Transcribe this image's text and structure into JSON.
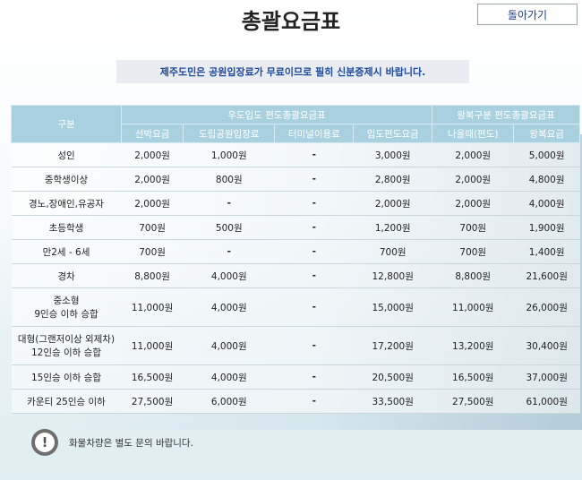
{
  "header": {
    "title": "총괄요금표",
    "back_label": "돌아가기"
  },
  "notice": "제주도민은 공원입장료가 무료이므로 필히 신분증제시 바랍니다.",
  "table": {
    "gubun_label": "구분",
    "group1_label": "우도입도 편도총괄요금표",
    "group2_label": "왕복구분 편도총괄요금표",
    "columns": [
      "선박요금",
      "도립공원입장료",
      "터미널이용료",
      "입도편도요금",
      "나올때(편도)",
      "왕복요금"
    ],
    "rows": [
      {
        "label": "성인",
        "cells": [
          "2,000원",
          "1,000원",
          "-",
          "3,000원",
          "2,000원",
          "5,000원"
        ]
      },
      {
        "label": "중학생이상",
        "cells": [
          "2,000원",
          "800원",
          "-",
          "2,800원",
          "2,000원",
          "4,800원"
        ]
      },
      {
        "label": "경노,장애인,유공자",
        "cells": [
          "2,000원",
          "-",
          "-",
          "2,000원",
          "2,000원",
          "4,000원"
        ]
      },
      {
        "label": "초등학생",
        "cells": [
          "700원",
          "500원",
          "-",
          "1,200원",
          "700원",
          "1,900원"
        ]
      },
      {
        "label": "만2세 - 6세",
        "cells": [
          "700원",
          "-",
          "-",
          "700원",
          "700원",
          "1,400원"
        ]
      },
      {
        "label": "경차",
        "cells": [
          "8,800원",
          "4,000원",
          "-",
          "12,800원",
          "8,800원",
          "21,600원"
        ]
      },
      {
        "label": "중소형",
        "label2": "9인승 이하 승합",
        "cells": [
          "11,000원",
          "4,000원",
          "-",
          "15,000원",
          "11,000원",
          "26,000원"
        ]
      },
      {
        "label": "대형(그랜저이상 외제차)",
        "label2": "12인승 이하 승합",
        "cells": [
          "11,000원",
          "4,000원",
          "-",
          "17,200원",
          "13,200원",
          "30,400원"
        ]
      },
      {
        "label": "15인승 이하 승합",
        "cells": [
          "16,500원",
          "4,000원",
          "-",
          "20,500원",
          "16,500원",
          "37,000원"
        ]
      },
      {
        "label": "카운티 25인승 이하",
        "cells": [
          "27,500원",
          "6,000원",
          "-",
          "33,500원",
          "27,500원",
          "61,000원"
        ]
      }
    ]
  },
  "footnote": {
    "icon": "exclamation-icon",
    "text": "화물차량은 별도 문의 바랍니다."
  }
}
